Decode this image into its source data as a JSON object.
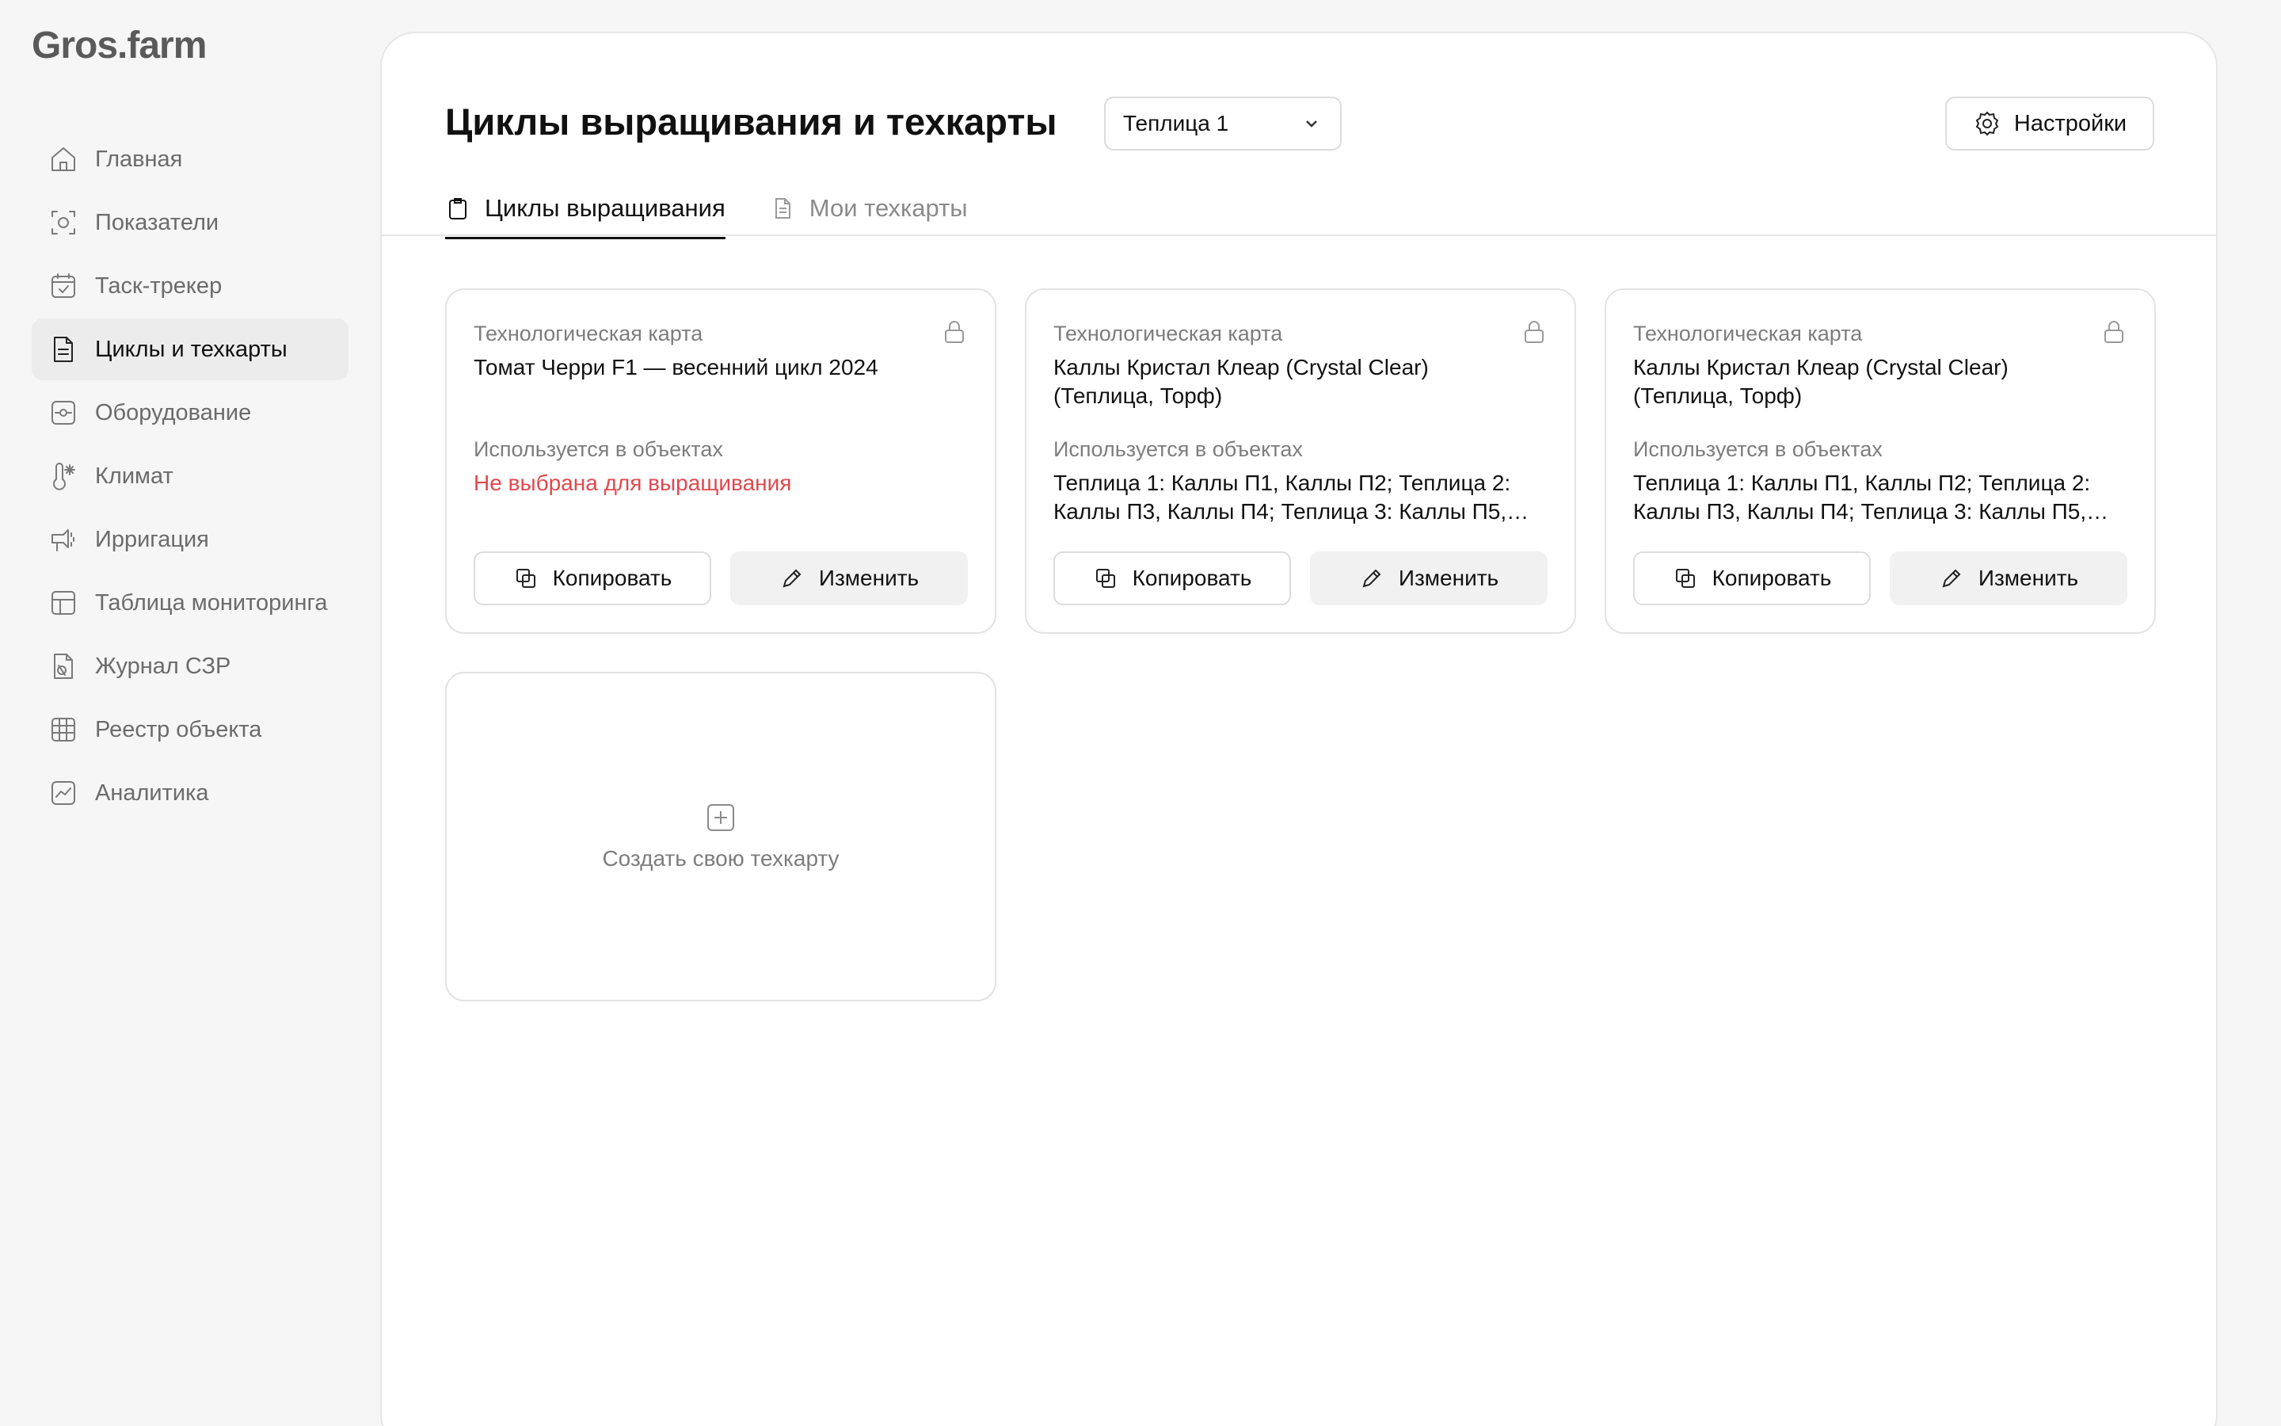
{
  "app": {
    "logo": "Gros.farm"
  },
  "sidebar": {
    "items": [
      {
        "label": "Главная",
        "icon": "home-icon"
      },
      {
        "label": "Показатели",
        "icon": "metrics-icon"
      },
      {
        "label": "Таск-трекер",
        "icon": "calendar-check-icon"
      },
      {
        "label": "Циклы и техкарты",
        "icon": "document-icon",
        "active": true
      },
      {
        "label": "Оборудование",
        "icon": "equipment-icon"
      },
      {
        "label": "Климат",
        "icon": "thermometer-icon"
      },
      {
        "label": "Ирригация",
        "icon": "irrigation-icon"
      },
      {
        "label": "Таблица мониторинга",
        "icon": "table-icon"
      },
      {
        "label": "Журнал СЗР",
        "icon": "journal-icon"
      },
      {
        "label": "Реестр объекта",
        "icon": "grid-icon"
      },
      {
        "label": "Аналитика",
        "icon": "analytics-icon"
      }
    ]
  },
  "header": {
    "title": "Циклы выращивания и техкарты",
    "greenhouse_select": {
      "value": "Теплица 1"
    },
    "settings_label": "Настройки"
  },
  "tabs": [
    {
      "label": "Циклы выращивания",
      "icon": "clipboard-icon",
      "active": true
    },
    {
      "label": "Мои техкарты",
      "icon": "file-text-icon",
      "active": false
    }
  ],
  "cards": [
    {
      "kind": "Технологическая карта",
      "name": "Томат Черри F1 — весенний цикл 2024",
      "used_label": "Используется в объектах",
      "used_value": "Не выбрана для выращивания",
      "used_warn": true,
      "copy_label": "Копировать",
      "edit_label": "Изменить"
    },
    {
      "kind": "Технологическая карта",
      "name": "Каллы Кристал Клеар (Crystal Clear) (Теплица, Торф)",
      "used_label": "Используется в объектах",
      "used_value": "Теплица 1: Каллы П1, Каллы П2; Теплица 2: Каллы П3, Каллы П4; Теплица 3: Каллы П5,…",
      "used_warn": false,
      "copy_label": "Копировать",
      "edit_label": "Изменить"
    },
    {
      "kind": "Технологическая карта",
      "name": "Каллы Кристал Клеар (Crystal Clear) (Теплица, Торф)",
      "used_label": "Используется в объектах",
      "used_value": "Теплица 1: Каллы П1, Каллы П2; Теплица 2: Каллы П3, Каллы П4; Теплица 3: Каллы П5,…",
      "used_warn": false,
      "copy_label": "Копировать",
      "edit_label": "Изменить"
    }
  ],
  "create_card": {
    "label": "Создать свою техкарту"
  },
  "colors": {
    "warning": "#e0494f",
    "active_nav_bg": "#ececec",
    "border": "#e3e3e3"
  }
}
